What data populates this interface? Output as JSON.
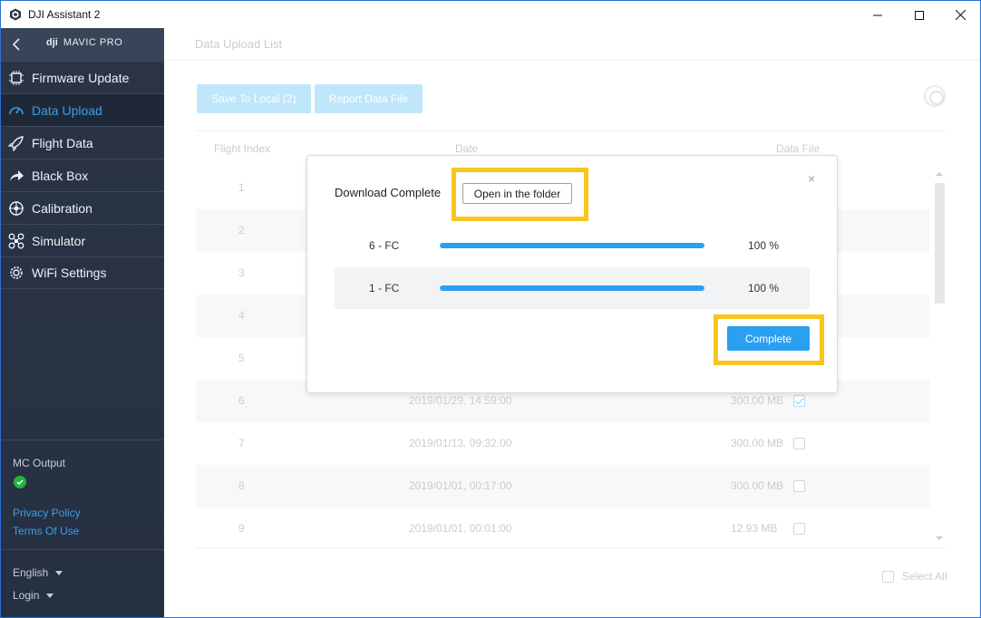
{
  "window": {
    "title": "DJI Assistant 2"
  },
  "sidebar": {
    "brand_logo": "dji",
    "brand_model": "MAVIC PRO",
    "items": [
      {
        "label": "Firmware Update",
        "icon": "chip-icon"
      },
      {
        "label": "Data Upload",
        "icon": "gauge-icon",
        "active": true
      },
      {
        "label": "Flight Data",
        "icon": "rocket-icon"
      },
      {
        "label": "Black Box",
        "icon": "share-arrow-icon"
      },
      {
        "label": "Calibration",
        "icon": "compass-icon"
      },
      {
        "label": "Simulator",
        "icon": "drone-icon"
      },
      {
        "label": "WiFi Settings",
        "icon": "wifi-gear-icon"
      }
    ],
    "mc_output_label": "MC Output",
    "privacy_policy": "Privacy Policy",
    "terms_of_use": "Terms Of Use",
    "language": "English",
    "login": "Login"
  },
  "main": {
    "page_title": "Data Upload List",
    "save_button": "Save To Local (2)",
    "report_button": "Report Data File",
    "columns": [
      "Flight Index",
      "Date",
      "Data File"
    ],
    "rows": [
      {
        "index": "1",
        "date": "",
        "size": "",
        "checked": false
      },
      {
        "index": "2",
        "date": "",
        "size": "",
        "checked": false
      },
      {
        "index": "3",
        "date": "",
        "size": "",
        "checked": false
      },
      {
        "index": "4",
        "date": "",
        "size": "",
        "checked": false
      },
      {
        "index": "5",
        "date": "",
        "size": "",
        "checked": false
      },
      {
        "index": "6",
        "date": "2019/01/29, 14:59:00",
        "size": "300.00 MB",
        "checked": true
      },
      {
        "index": "7",
        "date": "2019/01/13, 09:32:00",
        "size": "300.00 MB",
        "checked": false
      },
      {
        "index": "8",
        "date": "2019/01/01, 00:17:00",
        "size": "300.00 MB",
        "checked": false
      },
      {
        "index": "9",
        "date": "2019/01/01, 00:01:00",
        "size": "12.93 MB",
        "checked": false
      }
    ],
    "select_all": "Select All"
  },
  "modal": {
    "heading": "Download Complete",
    "open_folder_button": "Open in the folder",
    "close": "×",
    "items": [
      {
        "name": "6 - FC",
        "percent_label": "100 %",
        "progress": 1.0
      },
      {
        "name": "1 - FC",
        "percent_label": "100 %",
        "progress": 1.0
      }
    ],
    "complete_button": "Complete"
  },
  "colors": {
    "accent": "#2b9ff0",
    "sidebar_bg": "#2a3445",
    "highlight": "#f7c51c",
    "ok_green": "#1fb53a"
  }
}
